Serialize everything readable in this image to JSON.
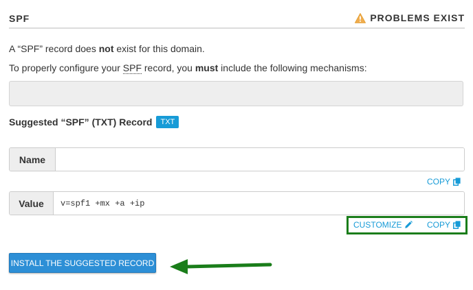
{
  "section": {
    "title": "SPF",
    "status": "PROBLEMS EXIST",
    "status_icon": "warning-icon",
    "status_icon_color": "#f0ad4e"
  },
  "message": {
    "line1_pre": "A “SPF” record does ",
    "line1_bold": "not",
    "line1_post": " exist for this domain.",
    "line2_pre": "To properly configure your ",
    "line2_abbr": "SPF",
    "line2_mid": " record, you ",
    "line2_bold": "must",
    "line2_post": " include the following mechanisms:"
  },
  "mechanisms_value": "",
  "suggested": {
    "heading": "Suggested “SPF” (TXT) Record",
    "badge": "TXT"
  },
  "name_field": {
    "label": "Name",
    "value": ""
  },
  "value_field": {
    "label": "Value",
    "value": "v=spf1 +mx +a +ip"
  },
  "actions": {
    "copy_label": "COPY",
    "customize_label": "CUSTOMIZE"
  },
  "install_button": "INSTALL THE SUGGESTED RECORD",
  "colors": {
    "accent": "#179bd7",
    "button": "#2d8fd6",
    "highlight": "#1a7d1a",
    "warning": "#f0ad4e"
  }
}
